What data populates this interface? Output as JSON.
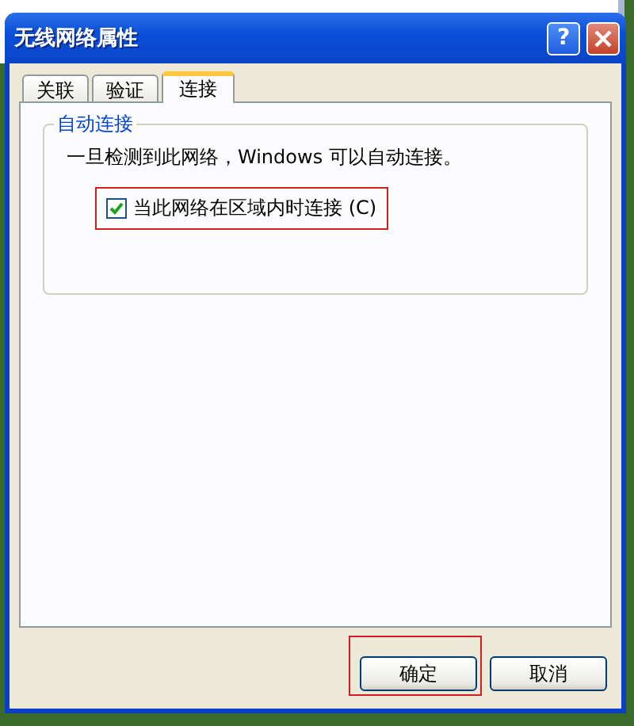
{
  "window": {
    "title": "无线网络属性",
    "help_button": "?"
  },
  "tabs": [
    {
      "label": "关联",
      "selected": false
    },
    {
      "label": "验证",
      "selected": false
    },
    {
      "label": "连接",
      "selected": true
    }
  ],
  "group": {
    "title": "自动连接",
    "description": "一旦检测到此网络，Windows 可以自动连接。",
    "checkbox": {
      "label": "当此网络在区域内时连接 (C)",
      "checked": true,
      "highlighted": true
    }
  },
  "buttons": [
    {
      "label": "确定",
      "highlighted": true
    },
    {
      "label": "取消",
      "highlighted": false
    }
  ]
}
